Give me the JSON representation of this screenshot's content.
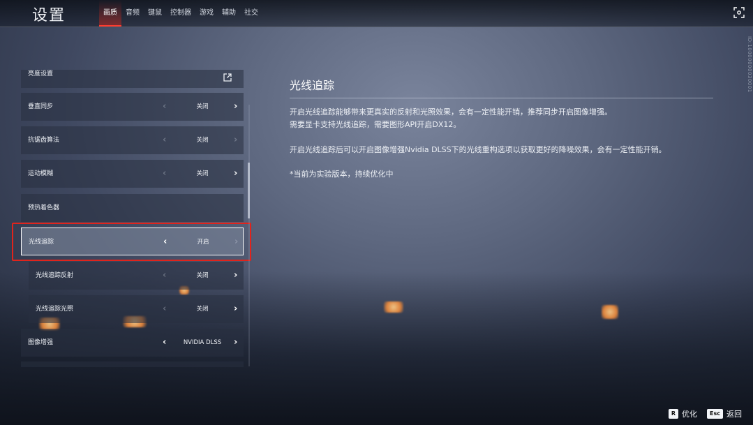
{
  "header": {
    "title": "设置",
    "tabs": [
      {
        "label": "画质",
        "active": true
      },
      {
        "label": "音频",
        "active": false
      },
      {
        "label": "键鼠",
        "active": false
      },
      {
        "label": "控制器",
        "active": false
      },
      {
        "label": "游戏",
        "active": false
      },
      {
        "label": "辅助",
        "active": false
      },
      {
        "label": "社交",
        "active": false
      }
    ],
    "capture_icon": "screen-capture-icon"
  },
  "settings": {
    "rows": [
      {
        "label": "亮度设置",
        "icon": "external-open-icon"
      },
      {
        "label": "垂直同步",
        "value": "关闭"
      },
      {
        "label": "抗锯齿算法",
        "value": "关闭"
      },
      {
        "label": "运动模糊",
        "value": "关闭"
      },
      {
        "label": "预热着色器"
      },
      {
        "label": "光线追踪",
        "value": "开启",
        "selected": true
      },
      {
        "label": "光线追踪反射",
        "value": "关闭",
        "sub": true
      },
      {
        "label": "光线追踪光照",
        "value": "关闭",
        "sub": true
      },
      {
        "label": "图像增强",
        "value": "NVIDIA DLSS"
      }
    ]
  },
  "detail": {
    "title": "光线追踪",
    "line1": "开启光线追踪能够带来更真实的反射和光照效果，会有一定性能开销，推荐同步开启图像增强。",
    "line2": "需要显卡支持光线追踪，需要图形API开启DX12。",
    "line3": "开启光线追踪后可以开启图像增强Nvidia DLSS下的光线重构选项以获取更好的降噪效果，会有一定性能开销。",
    "line4": "*当前为实验版本，持续优化中"
  },
  "side_id": "ID:10000000030001",
  "footer": {
    "hints": [
      {
        "key": "R",
        "label": "优化"
      },
      {
        "key": "Esc",
        "label": "返回"
      }
    ]
  },
  "colors": {
    "accent": "#ff3b2e",
    "highlight_border": "#e0241c"
  }
}
